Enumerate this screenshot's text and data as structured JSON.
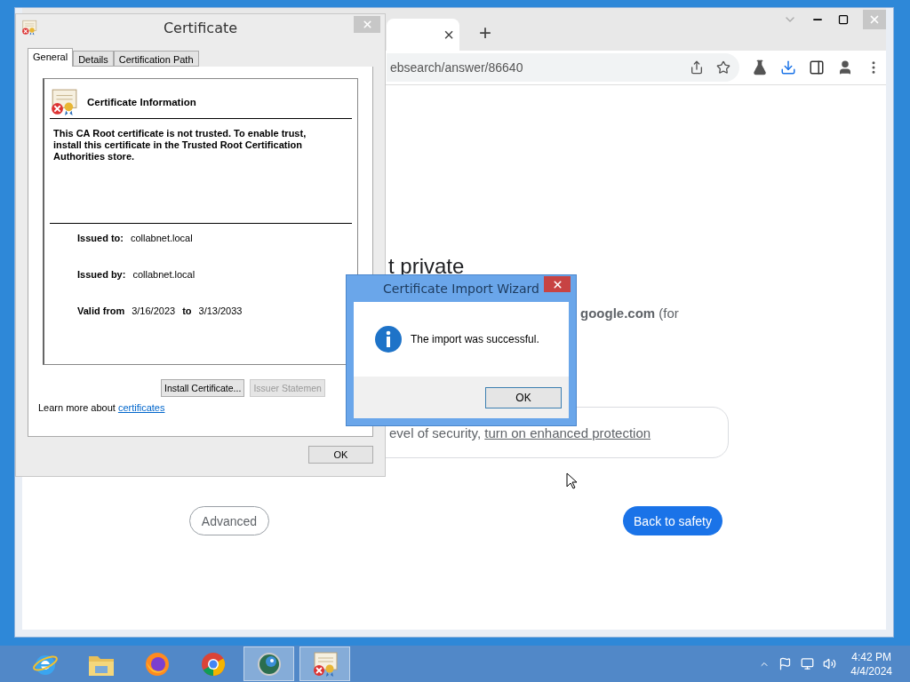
{
  "browser": {
    "tab_close": "×",
    "new_tab": "+",
    "address": {
      "value": "ebsearch/answer/86640"
    },
    "page": {
      "heading": "t private",
      "domain": "google.com",
      "domain_suffix": " (for",
      "security_text": "evel of security, ",
      "security_link": "turn on enhanced protection",
      "advanced_button": "Advanced",
      "back_button": "Back to safety"
    }
  },
  "certificate_window": {
    "title": "Certificate",
    "tabs": [
      {
        "label": "General",
        "selected": true
      },
      {
        "label": "Details",
        "selected": false
      },
      {
        "label": "Certification Path",
        "selected": false
      }
    ],
    "info_title": "Certificate Information",
    "message": "This CA Root certificate is not trusted. To enable trust, install this certificate in the Trusted Root Certification Authorities store.",
    "issued_to_label": "Issued to:",
    "issued_to": "collabnet.local",
    "issued_by_label": "Issued by:",
    "issued_by": "collabnet.local",
    "valid_from_label": "Valid from",
    "valid_from": "3/16/2023",
    "valid_to_label": "to",
    "valid_to": "3/13/2033",
    "buttons": [
      {
        "label": "Install Certificate...",
        "disabled": false
      },
      {
        "label": "Issuer Statemen",
        "disabled": true
      }
    ],
    "learn_more": "Learn more about ",
    "learn_more_link": "certificates",
    "ok_button": "OK"
  },
  "wizard": {
    "title": "Certificate Import Wizard",
    "message": "The import was successful.",
    "ok_button": "OK"
  },
  "taskbar": {
    "apps": [
      {
        "kind": "ie",
        "open": false
      },
      {
        "kind": "folder",
        "open": false
      },
      {
        "kind": "firefox",
        "open": false
      },
      {
        "kind": "chrome",
        "open": false
      },
      {
        "kind": "globe",
        "open": true
      },
      {
        "kind": "certificate",
        "open": true
      }
    ],
    "time": "4:42 PM",
    "date": "4/4/2024"
  }
}
